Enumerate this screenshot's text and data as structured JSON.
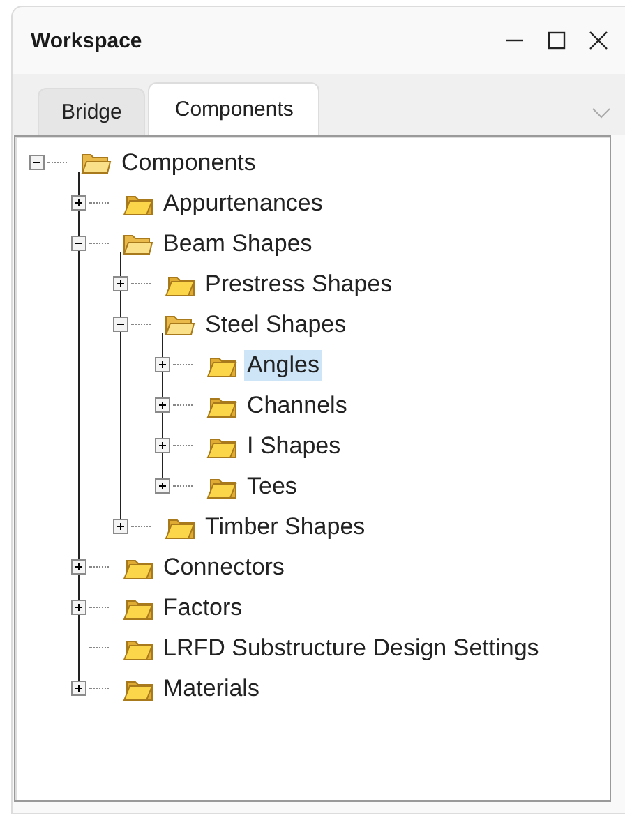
{
  "window": {
    "title": "Workspace"
  },
  "tabs": [
    {
      "label": "Bridge",
      "selected": false
    },
    {
      "label": "Components",
      "selected": true
    }
  ],
  "tree": [
    {
      "label": "Components",
      "expandable": true,
      "expanded": true,
      "selected": false,
      "children": [
        {
          "label": "Appurtenances",
          "expandable": true,
          "expanded": false,
          "selected": false
        },
        {
          "label": "Beam Shapes",
          "expandable": true,
          "expanded": true,
          "selected": false,
          "children": [
            {
              "label": "Prestress Shapes",
              "expandable": true,
              "expanded": false,
              "selected": false
            },
            {
              "label": "Steel Shapes",
              "expandable": true,
              "expanded": true,
              "selected": false,
              "children": [
                {
                  "label": "Angles",
                  "expandable": true,
                  "expanded": false,
                  "selected": true
                },
                {
                  "label": "Channels",
                  "expandable": true,
                  "expanded": false,
                  "selected": false
                },
                {
                  "label": "I Shapes",
                  "expandable": true,
                  "expanded": false,
                  "selected": false
                },
                {
                  "label": "Tees",
                  "expandable": true,
                  "expanded": false,
                  "selected": false
                }
              ]
            },
            {
              "label": "Timber Shapes",
              "expandable": true,
              "expanded": false,
              "selected": false
            }
          ]
        },
        {
          "label": "Connectors",
          "expandable": true,
          "expanded": false,
          "selected": false
        },
        {
          "label": "Factors",
          "expandable": true,
          "expanded": false,
          "selected": false
        },
        {
          "label": "LRFD Substructure Design Settings",
          "expandable": false,
          "expanded": false,
          "selected": false
        },
        {
          "label": "Materials",
          "expandable": true,
          "expanded": false,
          "selected": false
        }
      ]
    }
  ]
}
